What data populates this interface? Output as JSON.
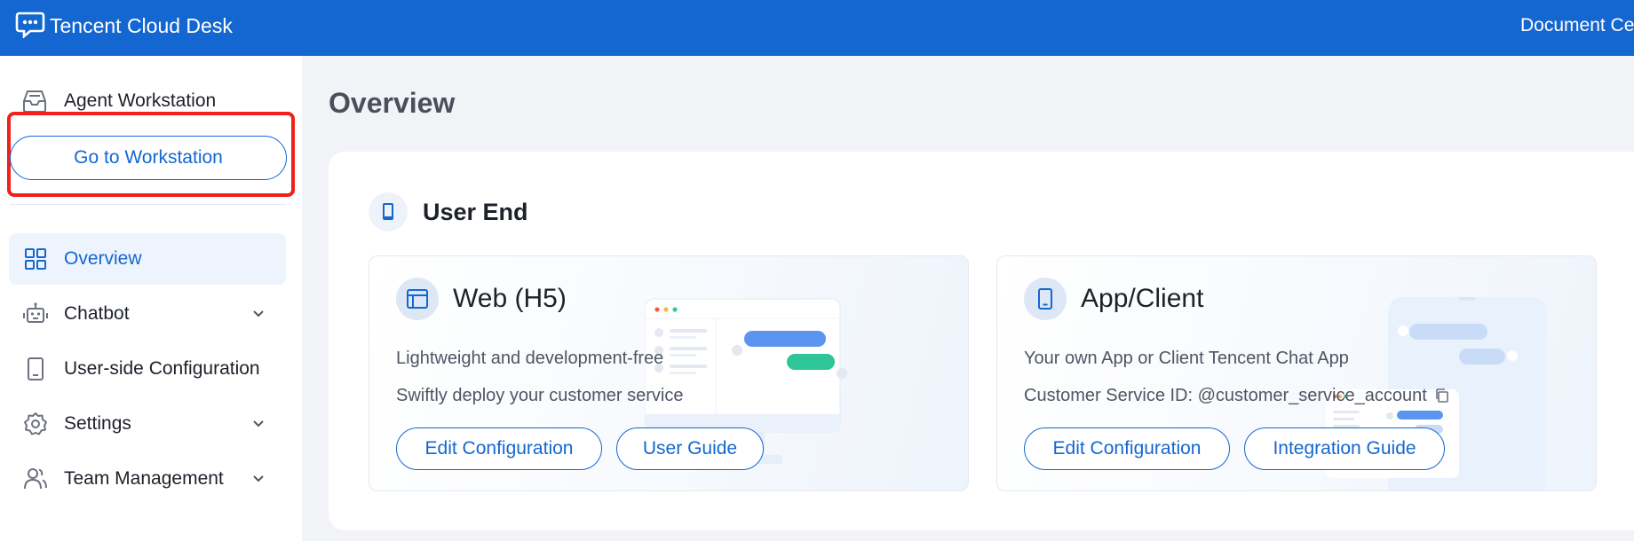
{
  "topbar": {
    "brand": "Tencent Cloud Desk",
    "document_center": "Document Center"
  },
  "sidebar": {
    "workstation_heading": "Agent Workstation",
    "goto_button": "Go to Workstation",
    "items": [
      {
        "label": "Overview",
        "icon": "grid-icon",
        "active": true
      },
      {
        "label": "Chatbot",
        "icon": "robot-icon",
        "expandable": true
      },
      {
        "label": "User-side Configuration",
        "icon": "tablet-icon"
      },
      {
        "label": "Settings",
        "icon": "gear-icon",
        "expandable": true
      },
      {
        "label": "Team Management",
        "icon": "team-icon",
        "expandable": true
      }
    ]
  },
  "main": {
    "page_title": "Overview",
    "section_title": "User End",
    "web": {
      "title": "Web (H5)",
      "desc1": "Lightweight and development-free",
      "desc2": "Swiftly deploy your customer service",
      "btn_edit": "Edit Configuration",
      "btn_guide": "User Guide"
    },
    "app": {
      "title": "App/Client",
      "desc1": "Your own App or Client Tencent Chat App",
      "desc2": "Customer Service ID: @customer_service_account",
      "btn_edit": "Edit Configuration",
      "btn_guide": "Integration Guide"
    }
  },
  "colors": {
    "brand_blue": "#1467d1",
    "highlight_red": "#f0201b",
    "active_bg": "#eef4fd",
    "page_bg": "#f2f3f7"
  }
}
